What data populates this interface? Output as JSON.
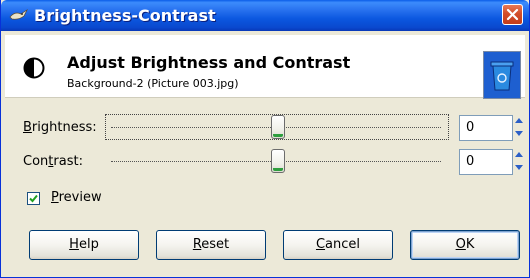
{
  "window": {
    "title": "Brightness-Contrast",
    "title_icon": "gimp-wilber-icon",
    "close_icon": "close-icon"
  },
  "header": {
    "title": "Adjust Brightness and Contrast",
    "subtitle": "Background-2 (Picture 003.jpg)",
    "icon": "contrast-icon",
    "thumbnail_icon": "recycle-bin-icon"
  },
  "brightness": {
    "label_underline": "B",
    "label_rest": "rightness:",
    "value": "0"
  },
  "contrast": {
    "label_pre": "Con",
    "label_underline": "t",
    "label_rest": "rast:",
    "value": "0"
  },
  "preview": {
    "checked": true,
    "label_underline": "P",
    "label_rest": "review"
  },
  "buttons": {
    "help": {
      "u": "H",
      "rest": "elp"
    },
    "reset": {
      "u": "R",
      "rest": "eset"
    },
    "cancel": {
      "u": "C",
      "rest": "ancel"
    },
    "ok": {
      "u": "O",
      "rest": "K"
    }
  },
  "colors": {
    "titlebar": "#0a5ce8",
    "dialog_bg": "#ece9d8",
    "thumb_accent": "#2e9e3e"
  }
}
